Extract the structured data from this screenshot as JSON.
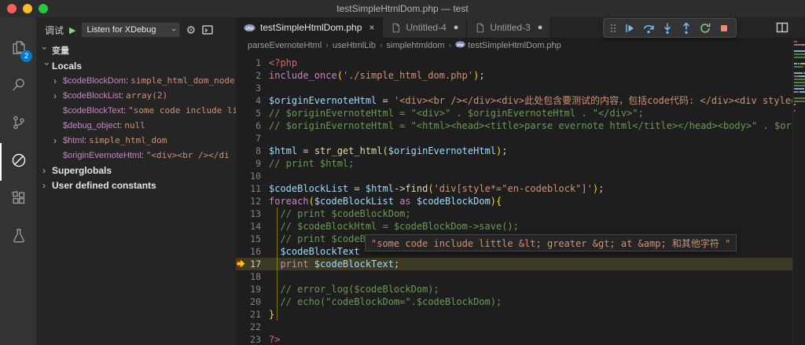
{
  "colors": {
    "accent": "#007acc",
    "titlebar_bg": "#2d2d2d",
    "activitybar_bg": "#333333",
    "sidebar_bg": "#252526",
    "editor_bg": "#1e1e1e",
    "string": "#ce9178",
    "comment": "#6a9955",
    "variable": "#9cdcfe",
    "keyword": "#c586c0",
    "function": "#dcdcaa",
    "bracket": "#ffd700",
    "php_tag": "#d16969",
    "punct": "#d4d4d4",
    "debug_blue": "#75beff",
    "debug_green": "#89d185",
    "debug_red": "#f48771",
    "breakpoint": "#e51400",
    "current_line_arrow": "#ffcc00",
    "traffic_close": "#ff5f57",
    "traffic_min": "#febc2e",
    "traffic_max": "#28c840"
  },
  "titlebar": {
    "title": "testSimpleHtmlDom.php — test"
  },
  "activity_bar": {
    "items": [
      {
        "name": "explorer",
        "icon": "files-icon",
        "badge": "2",
        "active": false
      },
      {
        "name": "search",
        "icon": "search-icon",
        "active": false
      },
      {
        "name": "source-control",
        "icon": "source-control-icon",
        "active": false
      },
      {
        "name": "run-and-debug",
        "icon": "debug-icon",
        "active": true
      },
      {
        "name": "extensions",
        "icon": "extensions-icon",
        "active": false
      },
      {
        "name": "testing",
        "icon": "beaker-icon",
        "active": false
      }
    ]
  },
  "sidebar": {
    "debug_label": "调试",
    "config_dropdown": "Listen for XDebug",
    "variables_section": "变量",
    "scopes": [
      {
        "label": "Locals",
        "expanded": true,
        "items": [
          {
            "name": "$codeBlockDom",
            "value": "simple_html_dom_node",
            "vtype": "object",
            "expandable": true
          },
          {
            "name": "$codeBlockList",
            "value": "array(2)",
            "vtype": "object",
            "expandable": true
          },
          {
            "name": "$codeBlockText",
            "value": "\"some code include li",
            "vtype": "string",
            "expandable": false
          },
          {
            "name": "$debug_object",
            "value": "null",
            "vtype": "primitive",
            "expandable": false
          },
          {
            "name": "$html",
            "value": "simple_html_dom",
            "vtype": "object",
            "expandable": true
          },
          {
            "name": "$originEvernoteHtml",
            "value": "\"<div><br /></di",
            "vtype": "string",
            "expandable": false
          }
        ]
      },
      {
        "label": "Superglobals",
        "expanded": false,
        "items": []
      },
      {
        "label": "User defined constants",
        "expanded": false,
        "items": []
      }
    ]
  },
  "debug_toolbar": {
    "buttons": [
      {
        "name": "continue"
      },
      {
        "name": "step-over"
      },
      {
        "name": "step-into"
      },
      {
        "name": "step-out"
      },
      {
        "name": "restart"
      },
      {
        "name": "stop"
      }
    ]
  },
  "editor": {
    "tabs": [
      {
        "label": "testSimpleHtmlDom.php",
        "icon": "php",
        "active": true,
        "close": true
      },
      {
        "label": "Untitled-4",
        "icon": "file",
        "dirty": true
      },
      {
        "label": "Untitled-3",
        "icon": "file",
        "dirty": true
      }
    ],
    "breadcrumbs": [
      "parseEvernoteHtml",
      "useHtmlLib",
      "simplehtmldom",
      "testSimpleHtmlDom.php"
    ],
    "current_line": 17,
    "hover_text": "\"some code include little &lt; greater &gt; at &amp; 和其他字符 \"",
    "lines": [
      {
        "n": 1,
        "tokens": [
          [
            "t",
            "<?php"
          ]
        ]
      },
      {
        "n": 2,
        "tokens": [
          [
            "k",
            "include_once"
          ],
          [
            "b",
            "("
          ],
          [
            "s",
            "'./simple_html_dom.php'"
          ],
          [
            "b",
            ")"
          ],
          [
            "p",
            ";"
          ]
        ]
      },
      {
        "n": 3,
        "tokens": []
      },
      {
        "n": 4,
        "tokens": [
          [
            "v",
            "$originEvernoteHtml"
          ],
          [
            "p",
            " = "
          ],
          [
            "s",
            "'<div><br /></div><div>此处包含要测试的内容，包括code代码: </div><div style=\"box-siz"
          ]
        ]
      },
      {
        "n": 5,
        "tokens": [
          [
            "c",
            "// $originEvernoteHtml = \"<div>\" . $originEvernoteHtml . \"</div>\";"
          ]
        ]
      },
      {
        "n": 6,
        "tokens": [
          [
            "c",
            "// $originEvernoteHtml = \"<html><head><title>parse evernote html</title></head><body>\" . $originEvern"
          ]
        ]
      },
      {
        "n": 7,
        "tokens": []
      },
      {
        "n": 8,
        "tokens": [
          [
            "v",
            "$html"
          ],
          [
            "p",
            " = "
          ],
          [
            "f",
            "str_get_html"
          ],
          [
            "b",
            "("
          ],
          [
            "v",
            "$originEvernoteHtml"
          ],
          [
            "b",
            ")"
          ],
          [
            "p",
            ";"
          ]
        ]
      },
      {
        "n": 9,
        "tokens": [
          [
            "c",
            "// print $html;"
          ]
        ]
      },
      {
        "n": 10,
        "tokens": []
      },
      {
        "n": 11,
        "tokens": [
          [
            "v",
            "$codeBlockList"
          ],
          [
            "p",
            " = "
          ],
          [
            "v",
            "$html"
          ],
          [
            "p",
            "->"
          ],
          [
            "f",
            "find"
          ],
          [
            "b",
            "("
          ],
          [
            "s",
            "'div[style*=\"en-codeblock\"]'"
          ],
          [
            "b",
            ")"
          ],
          [
            "p",
            ";"
          ]
        ]
      },
      {
        "n": 12,
        "tokens": [
          [
            "k",
            "foreach"
          ],
          [
            "b",
            "("
          ],
          [
            "v",
            "$codeBlockList"
          ],
          [
            "k",
            " as "
          ],
          [
            "v",
            "$codeBlockDom"
          ],
          [
            "b",
            ")"
          ],
          [
            "b",
            "{"
          ]
        ]
      },
      {
        "n": 13,
        "tokens": [
          [
            "c",
            "  // print $codeBlockDom;"
          ]
        ]
      },
      {
        "n": 14,
        "tokens": [
          [
            "c",
            "  // $codeBlockHtml = $codeBlockDom->save();"
          ]
        ]
      },
      {
        "n": 15,
        "tokens": [
          [
            "c",
            "  // print $codeBlockHtml;"
          ]
        ]
      },
      {
        "n": 16,
        "tokens": [
          [
            "p",
            "  "
          ],
          [
            "v",
            "$codeBlockText"
          ]
        ]
      },
      {
        "n": 17,
        "tokens": [
          [
            "p",
            "  "
          ],
          [
            "k",
            "print"
          ],
          [
            "v",
            " $codeBlockText"
          ],
          [
            "p",
            ";"
          ]
        ]
      },
      {
        "n": 18,
        "tokens": []
      },
      {
        "n": 19,
        "tokens": [
          [
            "c",
            "  // error_log($codeBlockDom);"
          ]
        ]
      },
      {
        "n": 20,
        "tokens": [
          [
            "c",
            "  // echo(\"codeBlockDom=\".$codeBlockDom);"
          ]
        ]
      },
      {
        "n": 21,
        "tokens": [
          [
            "b",
            "}"
          ]
        ]
      },
      {
        "n": 22,
        "tokens": []
      },
      {
        "n": 23,
        "tokens": [
          [
            "t",
            "?>"
          ]
        ]
      }
    ]
  }
}
